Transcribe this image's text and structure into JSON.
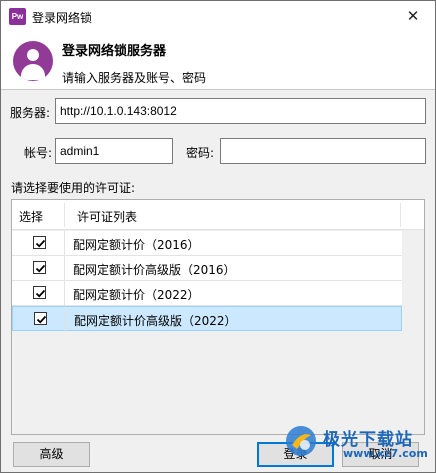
{
  "window": {
    "title": "登录网络锁",
    "app_icon_text": "Pw",
    "close_glyph": "✕"
  },
  "header": {
    "title": "登录网络锁服务器",
    "subtitle": "请输入服务器及账号、密码"
  },
  "form": {
    "server_label": "服务器:",
    "server_value": "http://10.1.0.143:8012",
    "account_label": "帐号:",
    "account_value": "admin1",
    "password_label": "密码:",
    "password_value": ""
  },
  "license": {
    "prompt": "请选择要使用的许可证:",
    "columns": [
      "选择",
      "许可证列表"
    ],
    "rows": [
      {
        "checked": true,
        "name": "配网定额计价（2016）",
        "selected": false
      },
      {
        "checked": true,
        "name": "配网定额计价高级版（2016）",
        "selected": false
      },
      {
        "checked": true,
        "name": "配网定额计价（2022）",
        "selected": false
      },
      {
        "checked": true,
        "name": "配网定额计价高级版（2022）",
        "selected": true
      }
    ]
  },
  "buttons": {
    "advanced": "高级",
    "login": "登录",
    "cancel": "取消"
  },
  "watermark": {
    "text": "极光下载站",
    "url": "www.xz7.com"
  },
  "colors": {
    "accent": "#0078d7",
    "brand": "#913a96",
    "selection": "#cce8ff"
  }
}
